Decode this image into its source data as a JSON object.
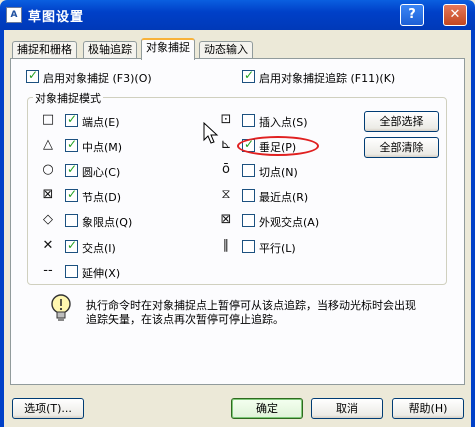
{
  "window": {
    "title": "草图设置",
    "app_icon": "autocad-icon",
    "help_button": "?",
    "close_button": "✕"
  },
  "tabs": [
    {
      "label": "捕捉和栅格"
    },
    {
      "label": "极轴追踪"
    },
    {
      "label": "对象捕捉"
    },
    {
      "label": "动态输入"
    }
  ],
  "options": {
    "enable_osnap": {
      "label": "启用对象捕捉 (F3)(O)",
      "checked": true
    },
    "enable_tracking": {
      "label": "启用对象捕捉追踪 (F11)(K)",
      "checked": true
    }
  },
  "modes": {
    "group_title": "对象捕捉模式",
    "left": [
      {
        "symbol": "□",
        "label": "端点(E)",
        "checked": true
      },
      {
        "symbol": "△",
        "label": "中点(M)",
        "checked": true
      },
      {
        "symbol": "○",
        "label": "圆心(C)",
        "checked": true
      },
      {
        "symbol": "⊠",
        "label": "节点(D)",
        "checked": true
      },
      {
        "symbol": "◇",
        "label": "象限点(Q)",
        "checked": false
      },
      {
        "symbol": "✕",
        "label": "交点(I)",
        "checked": true
      },
      {
        "symbol": "‐‐",
        "label": "延伸(X)",
        "checked": false
      }
    ],
    "right": [
      {
        "symbol": "⊡",
        "label": "插入点(S)",
        "checked": false
      },
      {
        "symbol": "⊾",
        "label": "垂足(P)",
        "checked": true
      },
      {
        "symbol": "ō",
        "label": "切点(N)",
        "checked": false
      },
      {
        "symbol": "⧖",
        "label": "最近点(R)",
        "checked": false
      },
      {
        "symbol": "⊠",
        "label": "外观交点(A)",
        "checked": false
      },
      {
        "symbol": "∥",
        "label": "平行(L)",
        "checked": false
      }
    ],
    "select_all": "全部选择",
    "clear_all": "全部清除"
  },
  "info": {
    "text": "执行命令时在对象捕捉点上暂停可从该点追踪，当移动光标时会出现追踪矢量，在该点再次暂停可停止追踪。"
  },
  "footer": {
    "options": "选项(T)...",
    "ok": "确定",
    "cancel": "取消",
    "help": "帮助(H)"
  }
}
